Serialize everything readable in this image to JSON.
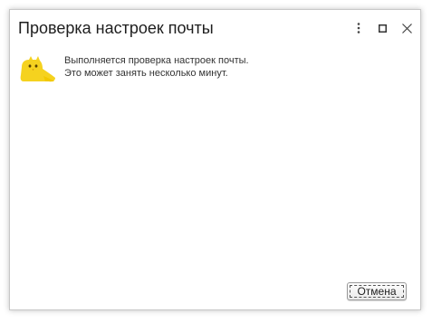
{
  "dialog": {
    "title": "Проверка настроек почты",
    "buttons": {
      "more_icon": "vertical-ellipsis-icon",
      "maximize_icon": "maximize-icon",
      "close_icon": "close-icon"
    }
  },
  "content": {
    "illustration_icon": "yellow-cat-icon",
    "message_line1": "Выполняется проверка настроек почты.",
    "message_line2": "Это может занять несколько минут."
  },
  "footer": {
    "cancel_label": "Отмена"
  },
  "colors": {
    "cat_yellow": "#f5d21f",
    "title_text": "#1e1e1e",
    "border": "#c8c8c8"
  }
}
